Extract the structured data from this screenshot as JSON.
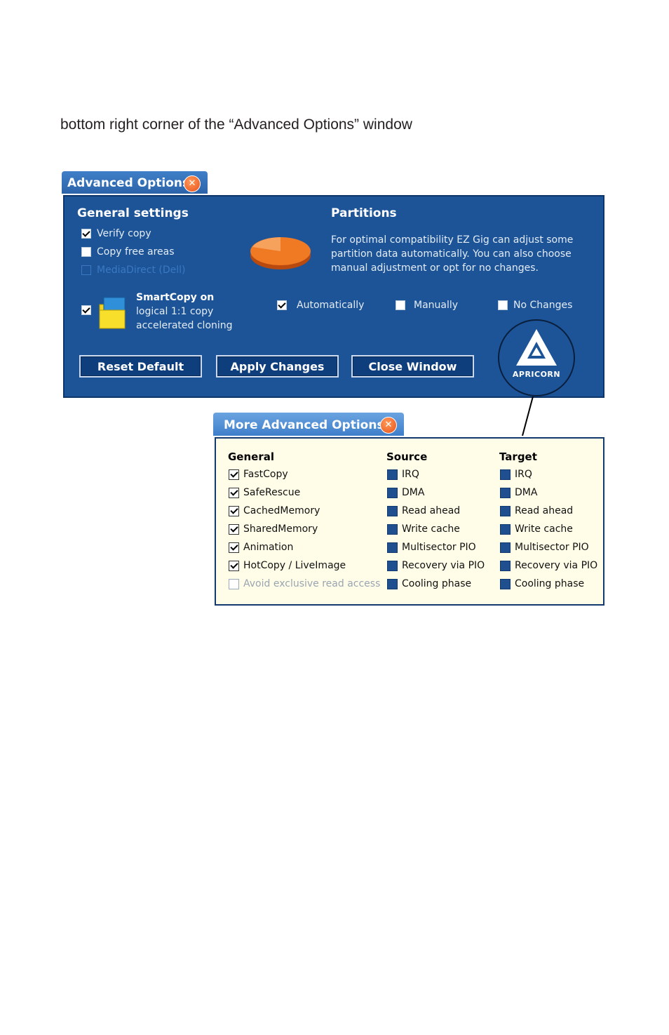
{
  "caption": "bottom right corner of the “Advanced Options” window",
  "advanced": {
    "title": "Advanced Options",
    "general_heading": "General settings",
    "general_options": [
      {
        "label": "Verify copy",
        "checked": true,
        "disabled": false
      },
      {
        "label": "Copy free areas",
        "checked": false,
        "disabled": false
      },
      {
        "label": "MediaDirect (Dell)",
        "checked": false,
        "disabled": true
      }
    ],
    "smartcopy": {
      "title": "SmartCopy on",
      "line1": "logical 1:1 copy",
      "line2": "accelerated cloning",
      "checked": true
    },
    "partitions_heading": "Partitions",
    "partitions_text": "For optimal compatibility EZ Gig can adjust some partition data automatically. You can also choose manual adjustment or opt for no changes.",
    "partition_options": [
      {
        "label": "Automatically",
        "checked": true
      },
      {
        "label": "Manually",
        "checked": false
      },
      {
        "label": "No Changes",
        "checked": false
      }
    ],
    "buttons": {
      "reset": "Reset Default",
      "apply": "Apply Changes",
      "close": "Close Window"
    },
    "logo_text": "APRICORN"
  },
  "more": {
    "title": "More Advanced Options",
    "general_heading": "General",
    "source_heading": "Source",
    "target_heading": "Target",
    "general": [
      {
        "label": "FastCopy",
        "checked": true
      },
      {
        "label": "SafeRescue",
        "checked": true
      },
      {
        "label": "CachedMemory",
        "checked": true
      },
      {
        "label": "SharedMemory",
        "checked": true
      },
      {
        "label": "Animation",
        "checked": true
      },
      {
        "label": "HotCopy / LiveImage",
        "checked": true
      },
      {
        "label": "Avoid exclusive read access",
        "checked": false
      }
    ],
    "source": [
      "IRQ",
      "DMA",
      "Read ahead",
      "Write cache",
      "Multisector PIO",
      "Recovery via PIO",
      "Cooling phase"
    ],
    "target": [
      "IRQ",
      "DMA",
      "Read ahead",
      "Write cache",
      "Multisector PIO",
      "Recovery via PIO",
      "Cooling phase"
    ]
  }
}
